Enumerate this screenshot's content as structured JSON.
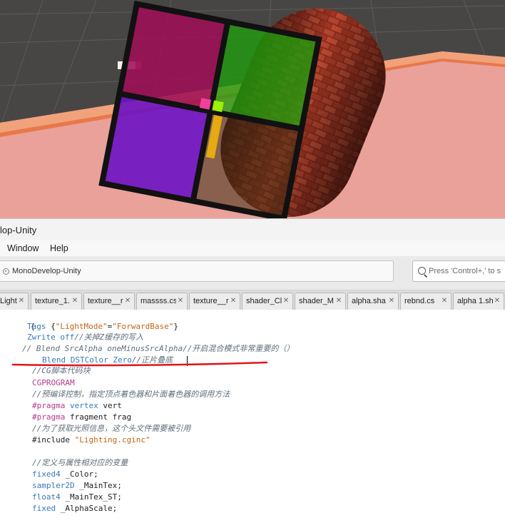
{
  "window": {
    "title": "lop-Unity"
  },
  "menu": {
    "items": [
      "Window",
      "Help"
    ]
  },
  "toolbar": {
    "status": "MonoDevelop-Unity",
    "search_placeholder": "Press 'Control+,' to s"
  },
  "tabs": [
    {
      "label": "Light"
    },
    {
      "label": "texture_1."
    },
    {
      "label": "texture__r"
    },
    {
      "label": "massss.cs"
    },
    {
      "label": "texture__r"
    },
    {
      "label": "shader_Cl"
    },
    {
      "label": "shader_M"
    },
    {
      "label": "alpha.sha"
    },
    {
      "label": "rebnd.cs"
    },
    {
      "label": "alpha 1.sh"
    }
  ],
  "code": {
    "brace": "{",
    "tags_kw": "Tags",
    "tags_open": " {",
    "tags_key": "\"LightMode\"",
    "tags_eq": "=",
    "tags_val": "\"ForwardBase\"",
    "tags_close": "}",
    "zwrite": "Zwrite off",
    "zwrite_comment": "//关掉Z缓存的写入",
    "blend_comment": "// Blend SrcAlpha oneMinusSrcAlpha//开启混合模式非常重要的（）",
    "blend_line": "Blend DSTColor Zero",
    "blend_line_comment": "//正片叠底",
    "cg_comment": "//CG脚本代码块",
    "cgprogram": "CGPROGRAM",
    "pre_comment": "//预编译控制，指定顶点着色器和片面着色器的调用方法",
    "pragma1_kw": "#pragma",
    "pragma1_kw2": "vertex",
    "pragma1_rest": "vert",
    "pragma2_kw": "#pragma",
    "pragma2_rest": "fragment frag",
    "include_comment": "//为了获取光照信息，这个头文件需要被引用",
    "include_kw": "#include",
    "include_val": "\"Lighting.cginc\"",
    "var_comment": "//定义与属性相对应的变量",
    "var1_type": "fixed4",
    "var1_name": "_Color;",
    "var2_type": "sampler2D",
    "var2_name": "_MainTex;",
    "var3_type": "float4",
    "var3_name": "_MainTex_ST;",
    "var4_type": "fixed",
    "var4_name": "_AlphaScale;"
  },
  "colors": {
    "keyword": "#3a78b8",
    "string": "#c2651a",
    "preprocessor": "#b33a8a",
    "comment": "#5f6e7c",
    "annotation_underline": "#e0141e"
  }
}
